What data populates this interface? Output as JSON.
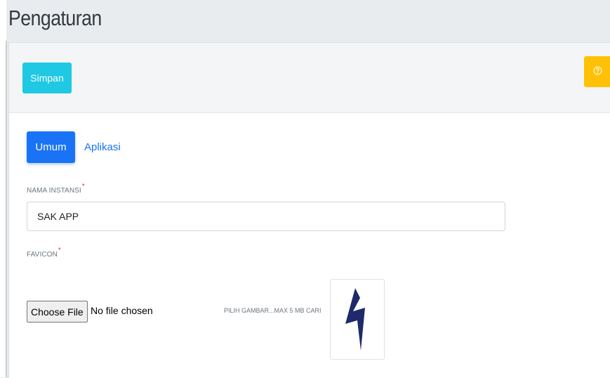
{
  "page": {
    "title": "Pengaturan"
  },
  "toolbar": {
    "save_label": "Simpan",
    "help_icon": "help-circle-icon"
  },
  "tabs": [
    {
      "label": "Umum",
      "active": true
    },
    {
      "label": "Aplikasi",
      "active": false
    }
  ],
  "form": {
    "nama_instansi": {
      "label": "NAMA INSTANSI",
      "required_mark": "*",
      "value": "SAK APP"
    },
    "favicon": {
      "label": "FAVICON",
      "required_mark": "*",
      "button_label": "Choose File",
      "status": "No file chosen",
      "hint": "PILIH GAMBAR...MAX 5 MB CARI",
      "preview_icon": "lightning-bolt-icon"
    }
  },
  "colors": {
    "save": "#1fc8e3",
    "help": "#ffc107",
    "tab_active": "#1a73f5",
    "required": "#dc3545",
    "bolt": "#1f2a6b"
  }
}
